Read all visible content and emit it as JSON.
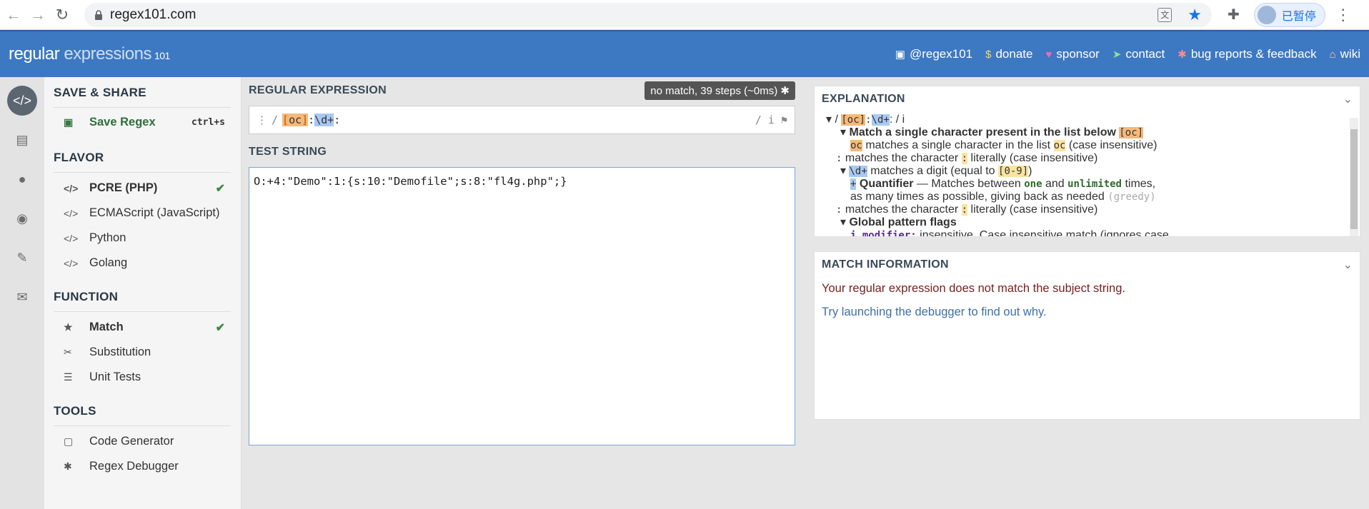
{
  "browser": {
    "url": "regex101.com",
    "profile_label": "已暂停",
    "translate_glyph": "文"
  },
  "header": {
    "logo_main": "regular",
    "logo_light": "expressions",
    "logo_ver": "101",
    "links": [
      {
        "icon": "twitter-icon",
        "label": "@regex101"
      },
      {
        "icon": "dollar-icon",
        "label": "donate"
      },
      {
        "icon": "heart-icon",
        "label": "sponsor"
      },
      {
        "icon": "paper-plane-icon",
        "label": "contact"
      },
      {
        "icon": "bug-icon",
        "label": "bug reports & feedback"
      },
      {
        "icon": "library-icon",
        "label": "wiki"
      }
    ]
  },
  "sidebar": {
    "save_share_title": "SAVE & SHARE",
    "save_regex_label": "Save Regex",
    "save_regex_shortcut": "ctrl+s",
    "flavor_title": "FLAVOR",
    "flavors": [
      "PCRE (PHP)",
      "ECMAScript (JavaScript)",
      "Python",
      "Golang"
    ],
    "function_title": "FUNCTION",
    "functions": [
      "Match",
      "Substitution",
      "Unit Tests"
    ],
    "tools_title": "TOOLS",
    "tools": [
      "Code Generator",
      "Regex Debugger"
    ]
  },
  "editor": {
    "regex_label": "REGULAR EXPRESSION",
    "status_badge": "no match, 39 steps (~0ms)",
    "delim_open": "/",
    "regex_class_open": "[",
    "regex_class_body": "oc",
    "regex_class_close": "]",
    "regex_colon1": ":",
    "regex_digit": "\\d+",
    "regex_colon2": ":",
    "regex_flags": "/ i",
    "test_label": "TEST STRING",
    "test_string": "O:+4:\"Demo\":1:{s:10:\"Demofile\";s:8:\"fl4g.php\";}"
  },
  "explanation": {
    "title": "EXPLANATION",
    "line_root_prefix": "/ ",
    "line_root_class": "[oc]",
    "line_root_colon": ":",
    "line_root_digit": "\\d+",
    "line_root_suffix": ": / i",
    "l1_text": "Match a single character present in the list below",
    "l1_code": "[oc]",
    "l2_code": "oc",
    "l2_text": "matches a single character in the list",
    "l2_code2": "oc",
    "l2_tail": "(case insensitive)",
    "l3_lead": ":",
    "l3_text": "matches the character",
    "l3_code": ":",
    "l3_tail": "literally (case insensitive)",
    "l4_code": "\\d+",
    "l4_text": "matches a digit (equal to",
    "l4_code2": "[0-9]",
    "l4_tail": ")",
    "l5_code": "+",
    "l5_bold": "Quantifier",
    "l5_text": "— Matches between",
    "l5_one": "one",
    "l5_and": "and",
    "l5_unl": "unlimited",
    "l5_times": "times,",
    "l6_text": "as many times as possible, giving back as needed",
    "l6_greedy": "(greedy)",
    "l7_lead": ":",
    "l7_text": "matches the character",
    "l7_code": ":",
    "l7_tail": "literally (case insensitive)",
    "l8_text": "Global pattern flags",
    "l9_code": "i modifier:",
    "l9_text": "insensitive. Case insensitive match (ignores case"
  },
  "match_info": {
    "title": "MATCH INFORMATION",
    "message": "Your regular expression does not match the subject string.",
    "debugger_link": "Try launching the debugger to find out why."
  },
  "colors": {
    "brand": "#3d78c2",
    "match_check": "#3a8a3a",
    "error_text": "#7a2020"
  }
}
